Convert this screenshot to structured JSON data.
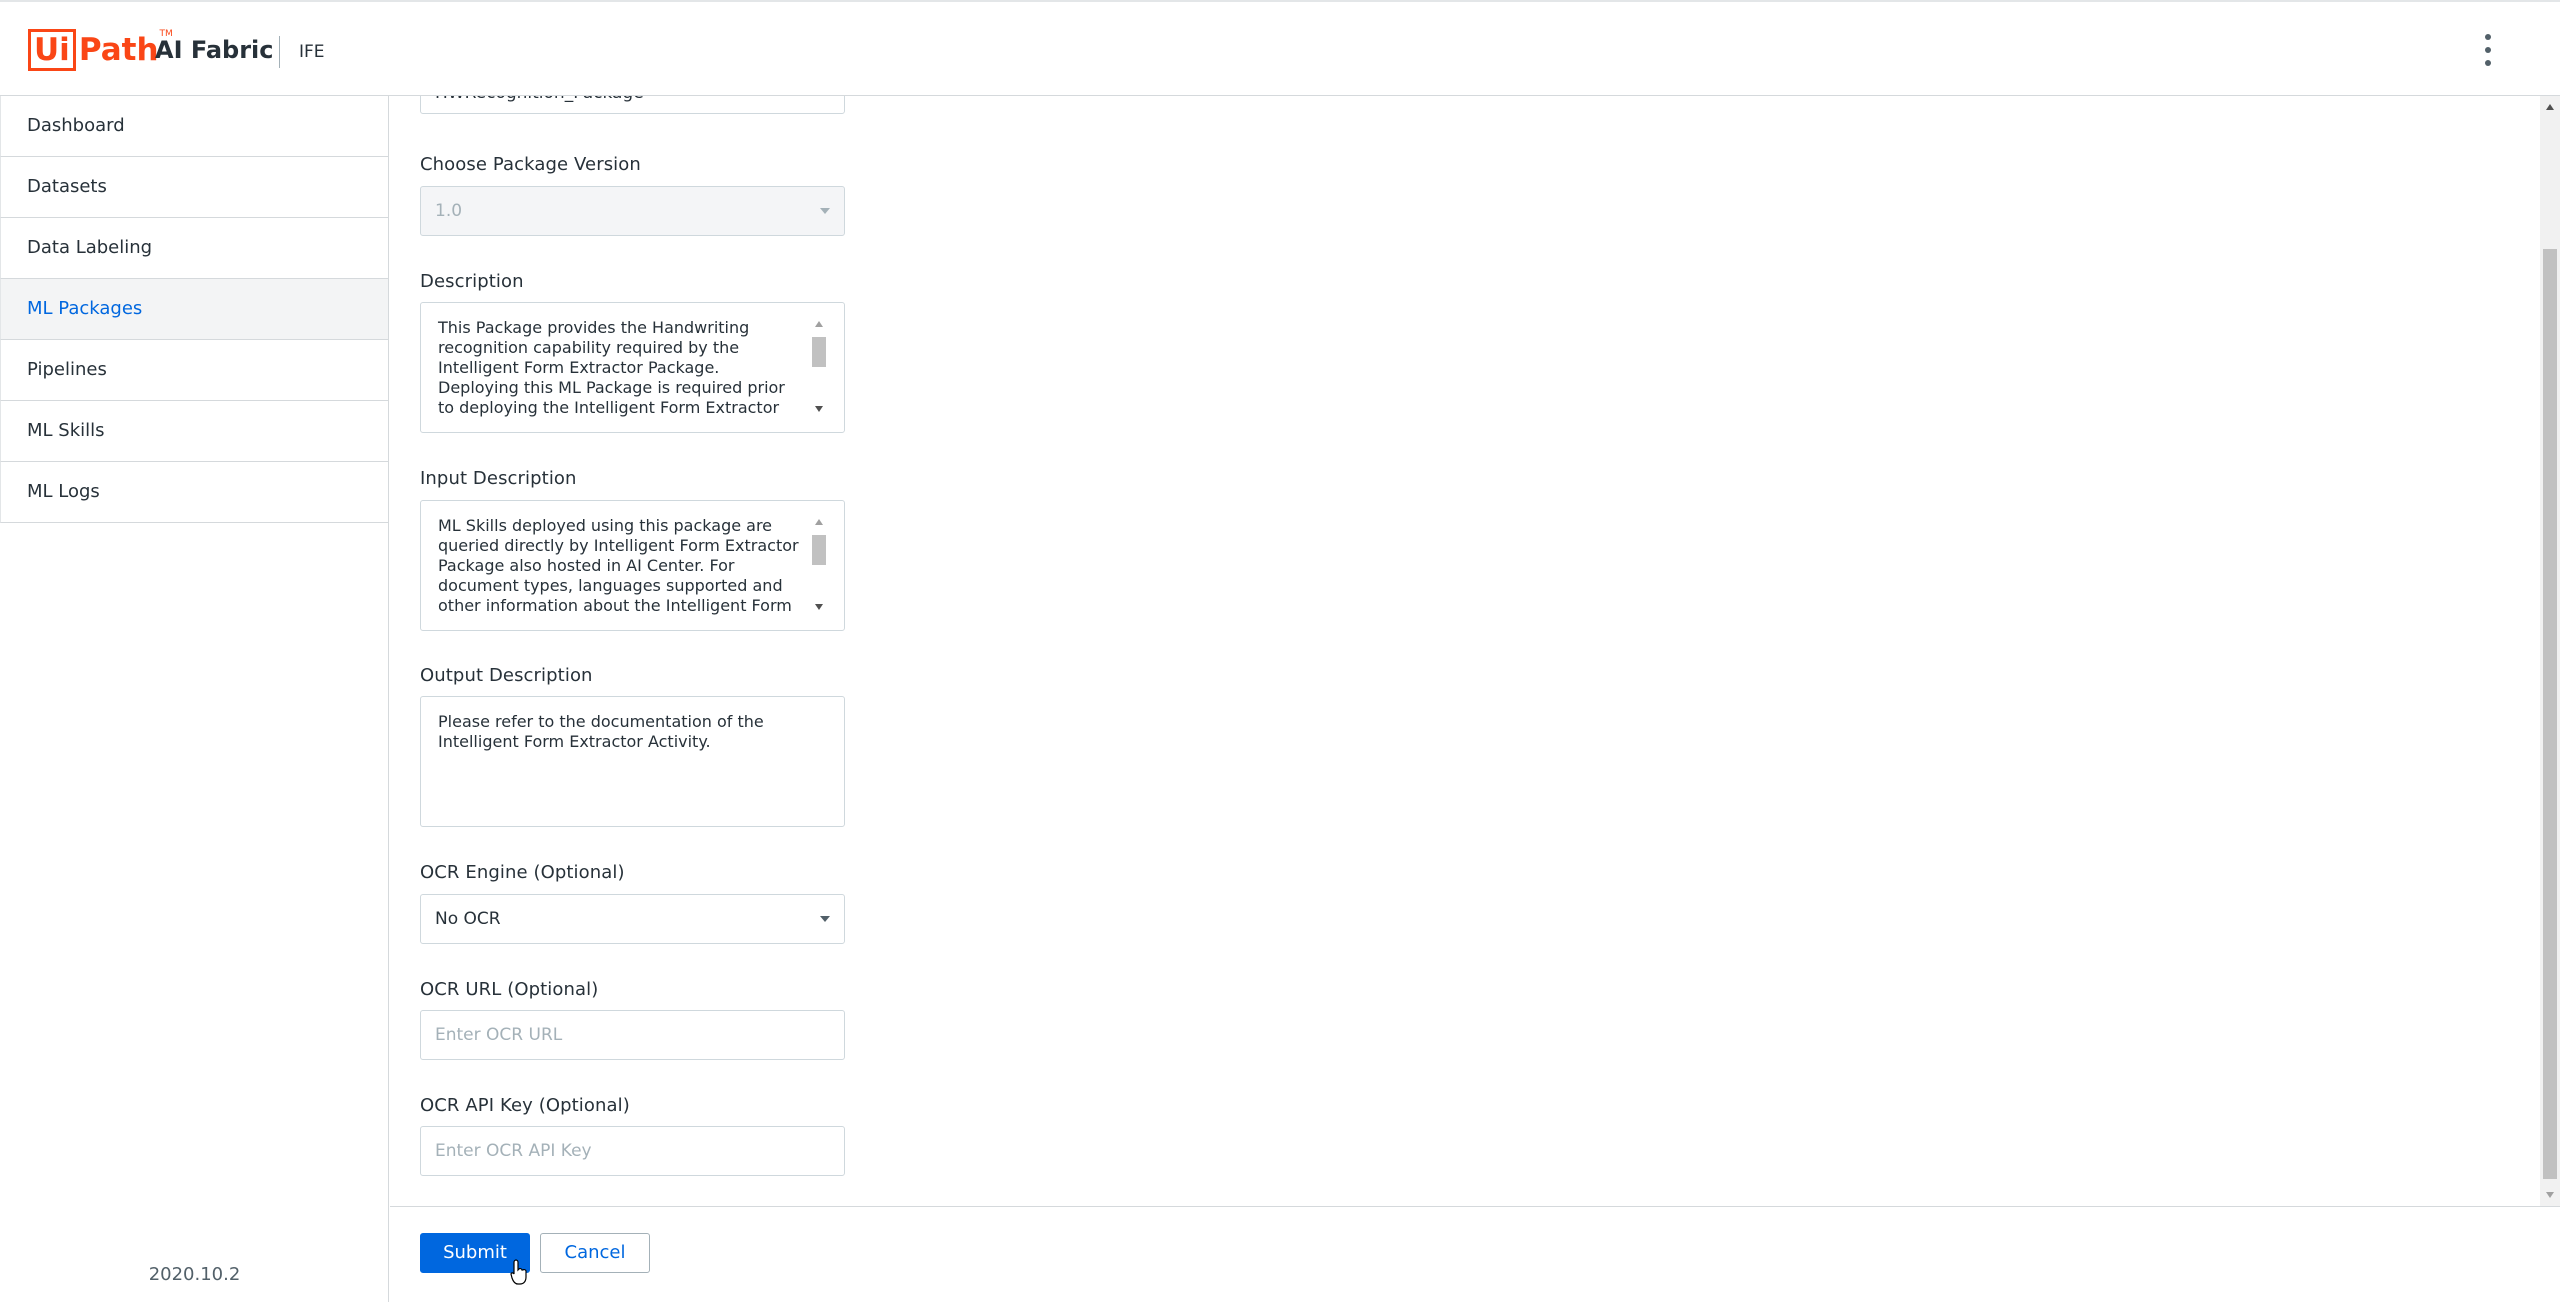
{
  "header": {
    "logo_ui": "Ui",
    "logo_path": "Path",
    "logo_tm": "TM",
    "product": "AI Fabric",
    "tenant": "IFE",
    "menu_icon": "kebab-menu-icon"
  },
  "sidebar": {
    "items": [
      {
        "label": "Dashboard",
        "active": false
      },
      {
        "label": "Datasets",
        "active": false
      },
      {
        "label": "Data Labeling",
        "active": false
      },
      {
        "label": "ML Packages",
        "active": true
      },
      {
        "label": "Pipelines",
        "active": false
      },
      {
        "label": "ML Skills",
        "active": false
      },
      {
        "label": "ML Logs",
        "active": false
      }
    ],
    "version": "2020.10.2"
  },
  "form": {
    "package_name_value": "HWRecognition_Package",
    "package_version": {
      "label": "Choose Package Version",
      "value": "1.0"
    },
    "description": {
      "label": "Description",
      "value": "This Package provides the Handwriting recognition capability required by the Intelligent Form Extractor Package. Deploying this ML Package is required prior to deploying the Intelligent Form Extractor"
    },
    "input_description": {
      "label": "Input Description",
      "value": "ML Skills deployed using this package are queried directly by Intelligent Form Extractor Package also hosted in AI Center. For document types, languages supported and other information about the Intelligent Form"
    },
    "output_description": {
      "label": "Output Description",
      "value": "Please refer to the documentation of the Intelligent Form Extractor Activity."
    },
    "ocr_engine": {
      "label": "OCR Engine (Optional)",
      "value": "No OCR"
    },
    "ocr_url": {
      "label": "OCR URL (Optional)",
      "placeholder": "Enter OCR URL"
    },
    "ocr_api_key": {
      "label": "OCR API Key (Optional)",
      "placeholder": "Enter OCR API Key"
    }
  },
  "footer": {
    "submit_label": "Submit",
    "cancel_label": "Cancel"
  },
  "colors": {
    "brand": "#fa4616",
    "primary": "#0067df",
    "border": "#cfd8dd"
  }
}
